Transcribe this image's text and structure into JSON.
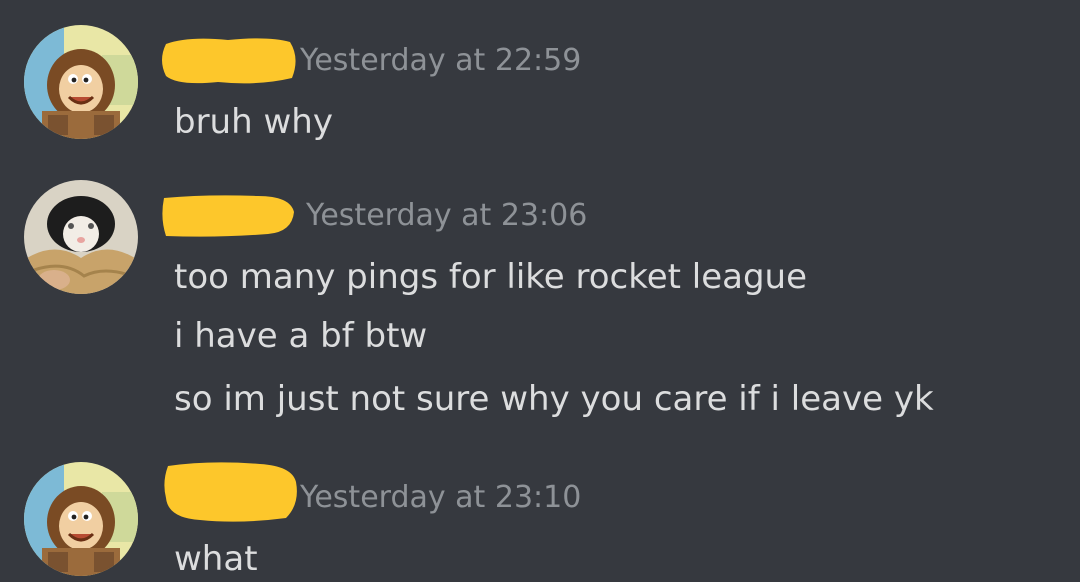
{
  "messages": [
    {
      "author_redacted": true,
      "avatar": "cartoon-monkey-avatar",
      "timestamp": "Yesterday at 22:59",
      "lines": [
        "bruh why"
      ]
    },
    {
      "author_redacted": true,
      "avatar": "kitten-avatar",
      "timestamp": "Yesterday at 23:06",
      "lines": [
        "too many pings for like rocket league",
        "i have a bf btw",
        "so im just not sure why you care if i leave yk"
      ]
    },
    {
      "author_redacted": true,
      "avatar": "cartoon-monkey-avatar",
      "timestamp": "Yesterday at 23:10",
      "lines": [
        "what"
      ]
    }
  ],
  "colors": {
    "background": "#36393f",
    "message_text": "#dcddde",
    "timestamp": "#8e9297",
    "redaction": "#fdc72b"
  }
}
